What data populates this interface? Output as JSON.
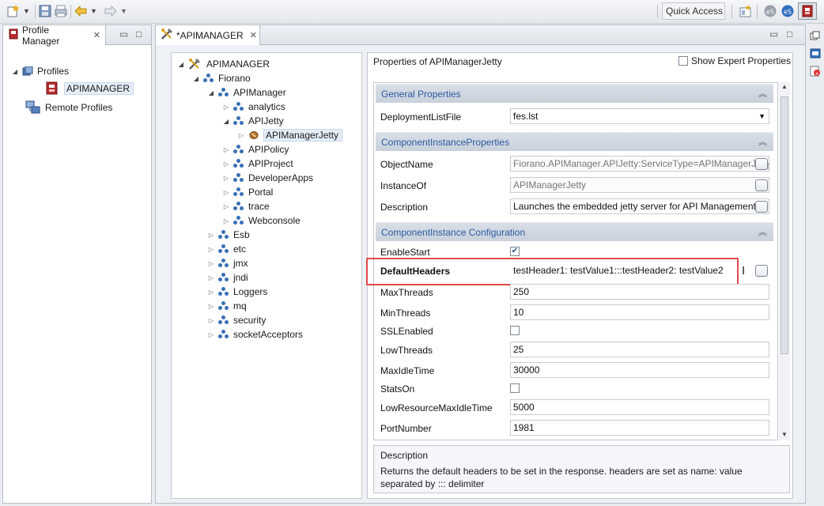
{
  "toolbar": {
    "quick_access": "Quick Access"
  },
  "profile_panel": {
    "tab_title": "Profile Manager",
    "tree": [
      {
        "label": "Profiles",
        "icon": "profiles-icon"
      },
      {
        "label": "APIMANAGER",
        "icon": "server-profile-icon"
      },
      {
        "label": "Remote Profiles",
        "icon": "remote-profiles-icon"
      }
    ]
  },
  "editor": {
    "tab_title": "*APIMANAGER",
    "tree": [
      {
        "label": "APIMANAGER",
        "icon": "tools-icon",
        "expanded": true
      },
      {
        "label": "Fiorano",
        "icon": "molecule-icon",
        "expanded": true
      },
      {
        "label": "APIManager",
        "icon": "molecule-icon",
        "expanded": true
      },
      {
        "label": "analytics",
        "icon": "molecule-icon"
      },
      {
        "label": "APIJetty",
        "icon": "molecule-icon",
        "expanded": true
      },
      {
        "label": "APIManagerJetty",
        "icon": "component-icon"
      },
      {
        "label": "APIPolicy",
        "icon": "molecule-icon"
      },
      {
        "label": "APIProject",
        "icon": "molecule-icon"
      },
      {
        "label": "DeveloperApps",
        "icon": "molecule-icon"
      },
      {
        "label": "Portal",
        "icon": "molecule-icon"
      },
      {
        "label": "trace",
        "icon": "molecule-icon"
      },
      {
        "label": "Webconsole",
        "icon": "molecule-icon"
      },
      {
        "label": "Esb",
        "icon": "molecule-icon"
      },
      {
        "label": "etc",
        "icon": "molecule-icon"
      },
      {
        "label": "jmx",
        "icon": "molecule-icon"
      },
      {
        "label": "jndi",
        "icon": "molecule-icon"
      },
      {
        "label": "Loggers",
        "icon": "molecule-icon"
      },
      {
        "label": "mq",
        "icon": "molecule-icon"
      },
      {
        "label": "security",
        "icon": "molecule-icon"
      },
      {
        "label": "socketAcceptors",
        "icon": "molecule-icon"
      }
    ]
  },
  "properties": {
    "title": "Properties of APIManagerJetty",
    "expert_label": "Show Expert Properties",
    "general": {
      "title": "General Properties",
      "deployment_label": "DeploymentListFile",
      "deployment_value": "fes.lst"
    },
    "component": {
      "title": "ComponentInstanceProperties",
      "object_name_label": "ObjectName",
      "object_name_value": "Fiorano.APIManager.APIJetty:ServiceType=APIManagerJetty",
      "instance_of_label": "InstanceOf",
      "instance_of_value": "APIManagerJetty",
      "description_label": "Description",
      "description_value": "Launches the embedded jetty server for API Management"
    },
    "config": {
      "title": "ComponentInstance Configuration",
      "enable_start_label": "EnableStart",
      "enable_start_checked": true,
      "default_headers_label": "DefaultHeaders",
      "default_headers_value": "testHeader1: testValue1:::testHeader2: testValue2",
      "max_threads_label": "MaxThreads",
      "max_threads_value": "250",
      "min_threads_label": "MinThreads",
      "min_threads_value": "10",
      "ssl_label": "SSLEnabled",
      "ssl_checked": false,
      "low_threads_label": "LowThreads",
      "low_threads_value": "25",
      "max_idle_label": "MaxIdleTime",
      "max_idle_value": "30000",
      "stats_label": "StatsOn",
      "stats_checked": false,
      "low_resource_label": "LowResourceMaxIdleTime",
      "low_resource_value": "5000",
      "port_label": "PortNumber",
      "port_value": "1981"
    },
    "description_box": {
      "title": "Description",
      "text": "Returns the default headers to be set in the response. headers are set as name: value separated by ::: delimiter"
    }
  },
  "colors": {
    "section_header_text": "#2b5aa0",
    "highlight_box": "#e24a4a",
    "tree_icon": "#3a6fb5"
  }
}
